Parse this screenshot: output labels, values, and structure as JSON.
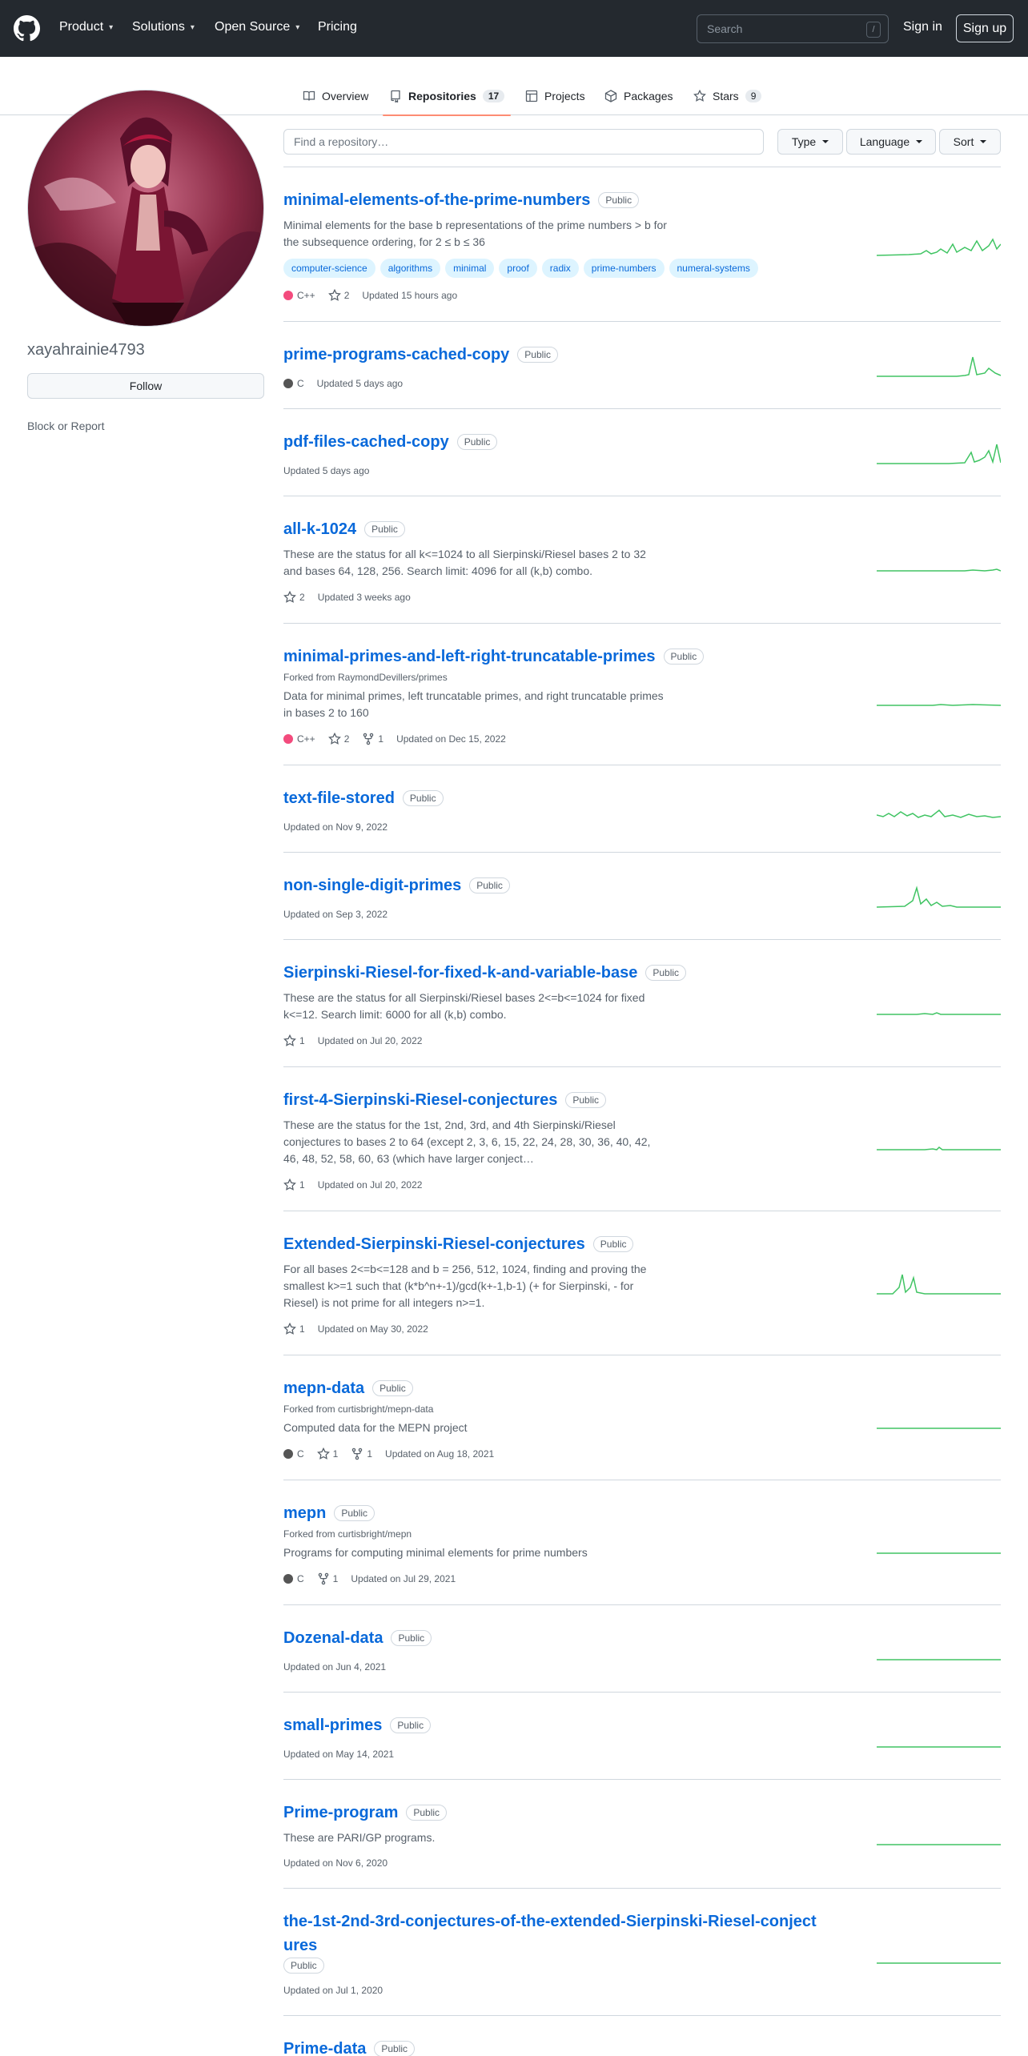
{
  "header": {
    "nav": [
      "Product",
      "Solutions",
      "Open Source",
      "Pricing"
    ],
    "search_placeholder": "Search",
    "search_key": "/",
    "signin": "Sign in",
    "signup": "Sign up"
  },
  "tabs": [
    {
      "label": "Overview",
      "count": ""
    },
    {
      "label": "Repositories",
      "count": "17"
    },
    {
      "label": "Projects",
      "count": ""
    },
    {
      "label": "Packages",
      "count": ""
    },
    {
      "label": "Stars",
      "count": "9"
    }
  ],
  "profile": {
    "username": "xayahrainie4793",
    "follow": "Follow",
    "block": "Block or Report"
  },
  "filters": {
    "find_placeholder": "Find a repository…",
    "type": "Type",
    "language": "Language",
    "sort": "Sort"
  },
  "colors": {
    "accent": "#0969da",
    "tab_underline": "#fd8c73",
    "cpp": "#f34b7d",
    "c": "#555555",
    "spark": "#40c463"
  },
  "repos": [
    {
      "name": "minimal-elements-of-the-prime-numbers",
      "visibility": "Public",
      "forked": "",
      "description": "Minimal elements for the base b representations of the prime numbers > b for the subsequence ordering, for 2 ≤ b ≤ 36",
      "topics": [
        "computer-science",
        "algorithms",
        "minimal",
        "proof",
        "radix",
        "prime-numbers",
        "numeral-systems"
      ],
      "language": "C++",
      "lang_color": "#f34b7d",
      "stars": "2",
      "forks": "",
      "updated": "Updated 15 hours ago"
    },
    {
      "name": "prime-programs-cached-copy",
      "visibility": "Public",
      "forked": "",
      "description": "",
      "topics": [],
      "language": "C",
      "lang_color": "#555555",
      "stars": "",
      "forks": "",
      "updated": "Updated 5 days ago"
    },
    {
      "name": "pdf-files-cached-copy",
      "visibility": "Public",
      "forked": "",
      "description": "",
      "topics": [],
      "language": "",
      "lang_color": "",
      "stars": "",
      "forks": "",
      "updated": "Updated 5 days ago"
    },
    {
      "name": "all-k-1024",
      "visibility": "Public",
      "forked": "",
      "description": "These are the status for all k<=1024 to all Sierpinski/Riesel bases 2 to 32 and bases 64, 128, 256. Search limit: 4096 for all (k,b) combo.",
      "topics": [],
      "language": "",
      "lang_color": "",
      "stars": "2",
      "forks": "",
      "updated": "Updated 3 weeks ago"
    },
    {
      "name": "minimal-primes-and-left-right-truncatable-primes",
      "visibility": "Public",
      "forked": "Forked from RaymondDevillers/primes",
      "description": "Data for minimal primes, left truncatable primes, and right truncatable primes in bases 2 to 160",
      "topics": [],
      "language": "C++",
      "lang_color": "#f34b7d",
      "stars": "2",
      "forks": "1",
      "updated": "Updated on Dec 15, 2022"
    },
    {
      "name": "text-file-stored",
      "visibility": "Public",
      "forked": "",
      "description": "",
      "topics": [],
      "language": "",
      "lang_color": "",
      "stars": "",
      "forks": "",
      "updated": "Updated on Nov 9, 2022"
    },
    {
      "name": "non-single-digit-primes",
      "visibility": "Public",
      "forked": "",
      "description": "",
      "topics": [],
      "language": "",
      "lang_color": "",
      "stars": "",
      "forks": "",
      "updated": "Updated on Sep 3, 2022"
    },
    {
      "name": "Sierpinski-Riesel-for-fixed-k-and-variable-base",
      "visibility": "Public",
      "forked": "",
      "description": "These are the status for all Sierpinski/Riesel bases 2<=b<=1024 for fixed k<=12. Search limit: 6000 for all (k,b) combo.",
      "topics": [],
      "language": "",
      "lang_color": "",
      "stars": "1",
      "forks": "",
      "updated": "Updated on Jul 20, 2022"
    },
    {
      "name": "first-4-Sierpinski-Riesel-conjectures",
      "visibility": "Public",
      "forked": "",
      "description": "These are the status for the 1st, 2nd, 3rd, and 4th Sierpinski/Riesel conjectures to bases 2 to 64 (except 2, 3, 6, 15, 22, 24, 28, 30, 36, 40, 42, 46, 48, 52, 58, 60, 63 (which have larger conject…",
      "topics": [],
      "language": "",
      "lang_color": "",
      "stars": "1",
      "forks": "",
      "updated": "Updated on Jul 20, 2022"
    },
    {
      "name": "Extended-Sierpinski-Riesel-conjectures",
      "visibility": "Public",
      "forked": "",
      "description": "For all bases 2<=b<=128 and b = 256, 512, 1024, finding and proving the smallest k>=1 such that (k*b^n+-1)/gcd(k+-1,b-1) (+ for Sierpinski, - for Riesel) is not prime for all integers n>=1.",
      "topics": [],
      "language": "",
      "lang_color": "",
      "stars": "1",
      "forks": "",
      "updated": "Updated on May 30, 2022"
    },
    {
      "name": "mepn-data",
      "visibility": "Public",
      "forked": "Forked from curtisbright/mepn-data",
      "description": "Computed data for the MEPN project",
      "topics": [],
      "language": "C",
      "lang_color": "#555555",
      "stars": "1",
      "forks": "1",
      "updated": "Updated on Aug 18, 2021"
    },
    {
      "name": "mepn",
      "visibility": "Public",
      "forked": "Forked from curtisbright/mepn",
      "description": "Programs for computing minimal elements for prime numbers",
      "topics": [],
      "language": "C",
      "lang_color": "#555555",
      "stars": "",
      "forks": "1",
      "updated": "Updated on Jul 29, 2021"
    },
    {
      "name": "Dozenal-data",
      "visibility": "Public",
      "forked": "",
      "description": "",
      "topics": [],
      "language": "",
      "lang_color": "",
      "stars": "",
      "forks": "",
      "updated": "Updated on Jun 4, 2021"
    },
    {
      "name": "small-primes",
      "visibility": "Public",
      "forked": "",
      "description": "",
      "topics": [],
      "language": "",
      "lang_color": "",
      "stars": "",
      "forks": "",
      "updated": "Updated on May 14, 2021"
    },
    {
      "name": "Prime-program",
      "visibility": "Public",
      "forked": "",
      "description": "These are PARI/GP programs.",
      "topics": [],
      "language": "",
      "lang_color": "",
      "stars": "",
      "forks": "",
      "updated": "Updated on Nov 6, 2020"
    },
    {
      "name": "the-1st-2nd-3rd-conjectures-of-the-extended-Sierpinski-Riesel-conjectures",
      "visibility": "Public",
      "forked": "",
      "description": "",
      "topics": [],
      "language": "",
      "lang_color": "",
      "stars": "",
      "forks": "",
      "updated": "Updated on Jul 1, 2020"
    },
    {
      "name": "Prime-data",
      "visibility": "Public",
      "forked": "",
      "description": "",
      "topics": [],
      "language": "",
      "lang_color": "",
      "stars": "",
      "forks": "",
      "updated": ""
    }
  ]
}
